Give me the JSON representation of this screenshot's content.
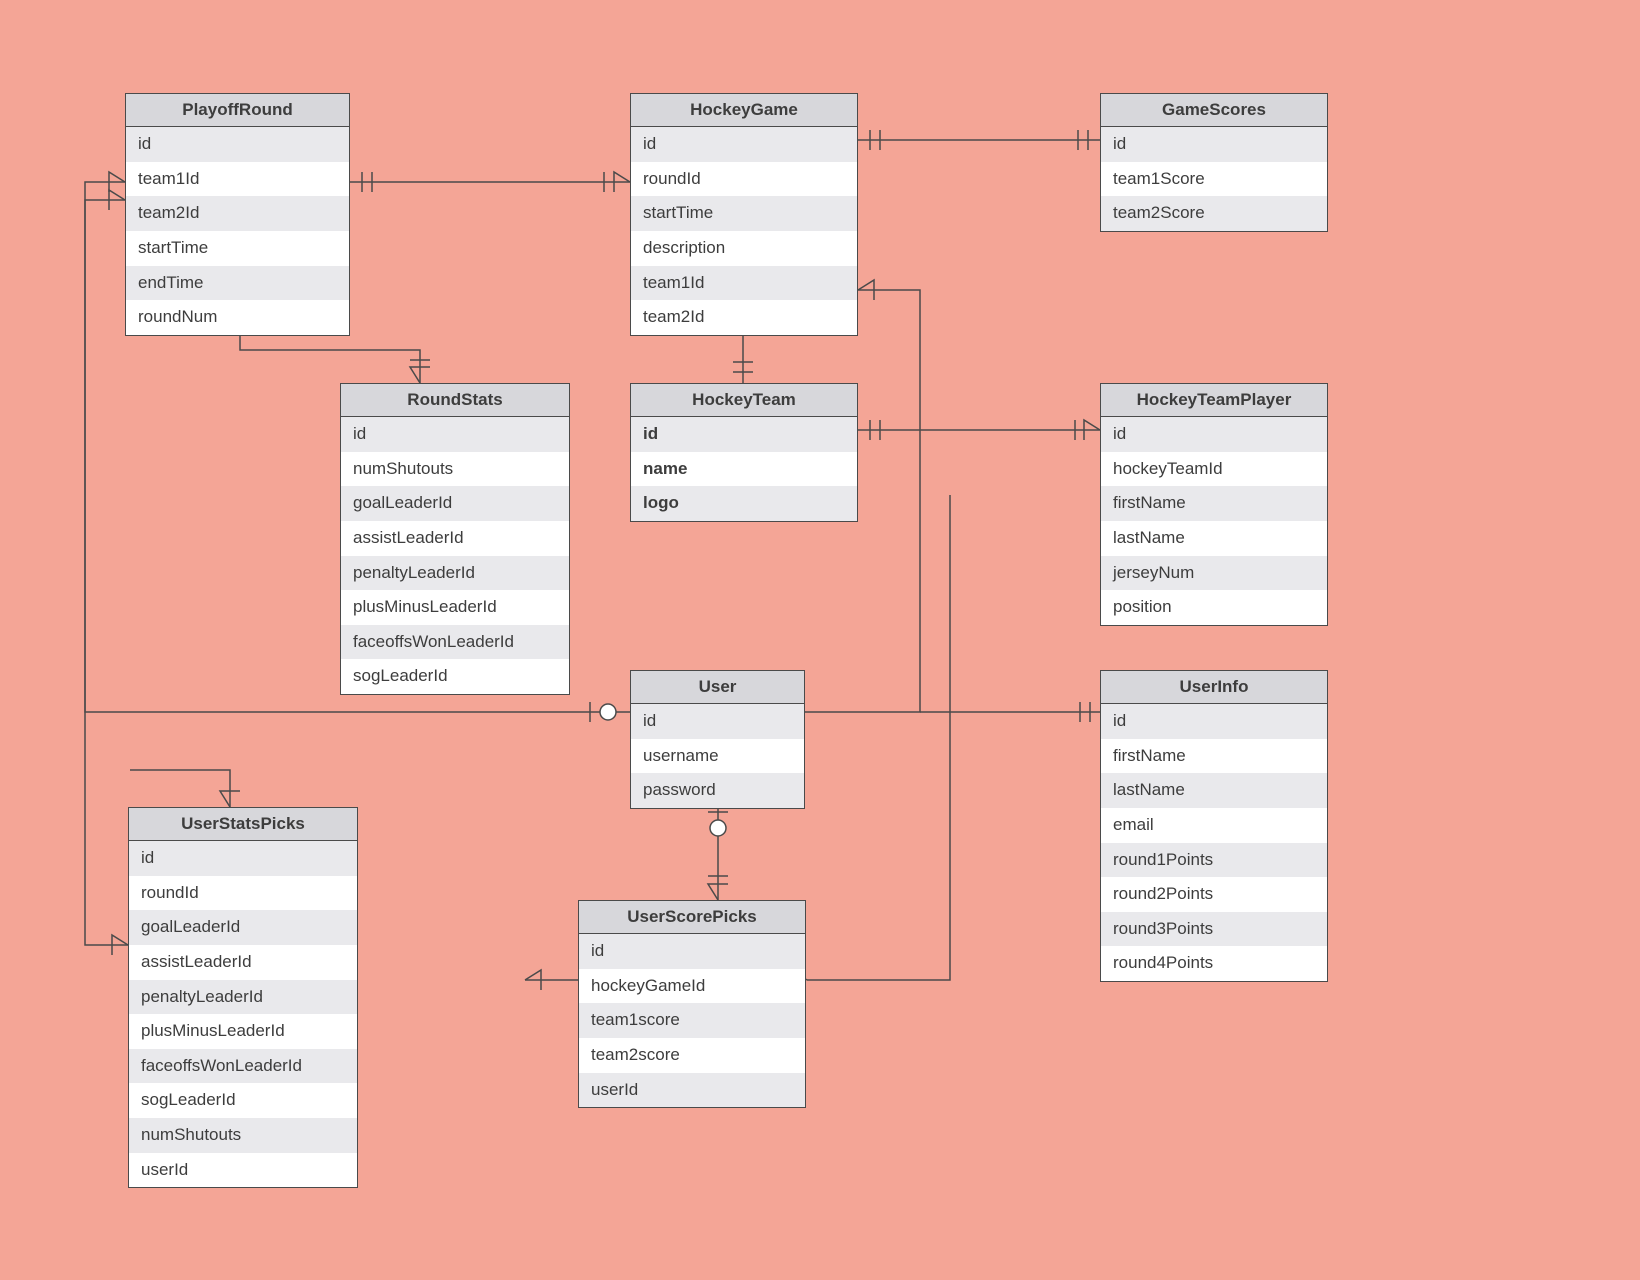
{
  "entities": {
    "playoffRound": {
      "title": "PlayoffRound",
      "fields": [
        "id",
        "team1Id",
        "team2Id",
        "startTime",
        "endTime",
        "roundNum"
      ]
    },
    "hockeyGame": {
      "title": "HockeyGame",
      "fields": [
        "id",
        "roundId",
        "startTime",
        "description",
        "team1Id",
        "team2Id"
      ]
    },
    "gameScores": {
      "title": "GameScores",
      "fields": [
        "id",
        "team1Score",
        "team2Score"
      ]
    },
    "roundStats": {
      "title": "RoundStats",
      "fields": [
        "id",
        "numShutouts",
        "goalLeaderId",
        "assistLeaderId",
        "penaltyLeaderId",
        "plusMinusLeaderId",
        "faceoffsWonLeaderId",
        "sogLeaderId"
      ]
    },
    "hockeyTeam": {
      "title": "HockeyTeam",
      "fields": [
        "id",
        "name",
        "logo"
      ],
      "boldFields": true
    },
    "hockeyTeamPlayer": {
      "title": "HockeyTeamPlayer",
      "fields": [
        "id",
        "hockeyTeamId",
        "firstName",
        "lastName",
        "jerseyNum",
        "position"
      ]
    },
    "user": {
      "title": "User",
      "fields": [
        "id",
        "username",
        "password"
      ]
    },
    "userInfo": {
      "title": "UserInfo",
      "fields": [
        "id",
        "firstName",
        "lastName",
        "email",
        "round1Points",
        "round2Points",
        "round3Points",
        "round4Points"
      ]
    },
    "userStatsPicks": {
      "title": "UserStatsPicks",
      "fields": [
        "id",
        "roundId",
        "goalLeaderId",
        "assistLeaderId",
        "penaltyLeaderId",
        "plusMinusLeaderId",
        "faceoffsWonLeaderId",
        "sogLeaderId",
        "numShutouts",
        "userId"
      ]
    },
    "userScorePicks": {
      "title": "UserScorePicks",
      "fields": [
        "id",
        "hockeyGameId",
        "team1score",
        "team2score",
        "userId"
      ]
    }
  }
}
